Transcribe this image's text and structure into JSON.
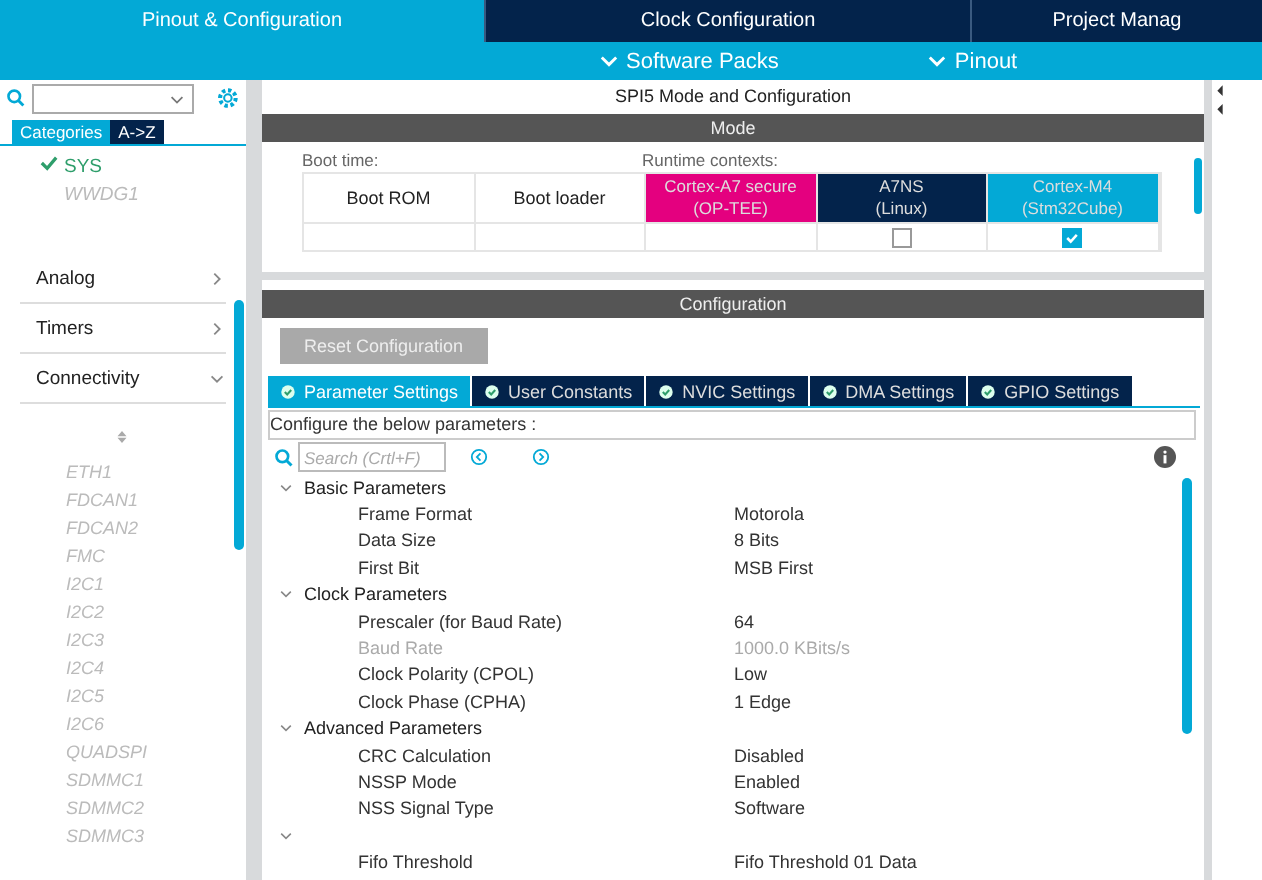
{
  "top_tabs": [
    {
      "label": "Pinout & Configuration",
      "selected": true
    },
    {
      "label": "Clock Configuration",
      "selected": false
    },
    {
      "label": "Project Manag",
      "selected": false
    }
  ],
  "sub_menu": [
    "Software Packs",
    "Pinout"
  ],
  "left": {
    "view_tabs": [
      {
        "label": "Categories",
        "selected": true
      },
      {
        "label": "A->Z",
        "selected": false
      }
    ],
    "peripherals": [
      {
        "label": "SYS",
        "enabled": true
      },
      {
        "label": "WWDG1",
        "enabled": false
      }
    ],
    "categories": [
      {
        "label": "Analog",
        "expanded": false
      },
      {
        "label": "Timers",
        "expanded": false
      },
      {
        "label": "Connectivity",
        "expanded": true,
        "children": [
          "ETH1",
          "FDCAN1",
          "FDCAN2",
          "FMC",
          "I2C1",
          "I2C2",
          "I2C3",
          "I2C4",
          "I2C5",
          "I2C6",
          "QUADSPI",
          "SDMMC1",
          "SDMMC2",
          "SDMMC3"
        ]
      }
    ]
  },
  "panel_title": "SPI5 Mode and Configuration",
  "mode": {
    "header": "Mode",
    "boot_time_label": "Boot time:",
    "runtime_label": "Runtime contexts:",
    "columns": [
      {
        "label": "Boot ROM"
      },
      {
        "label": "Boot loader"
      },
      {
        "label": "Cortex-A7 secure",
        "sublabel": "(OP-TEE)",
        "color": "#e4007f"
      },
      {
        "label": "A7NS",
        "sublabel": "(Linux)",
        "color": "#03234b",
        "checked": false
      },
      {
        "label": "Cortex-M4",
        "sublabel": "(Stm32Cube)",
        "color": "#03a9d6",
        "checked": true
      }
    ]
  },
  "configuration": {
    "header": "Configuration",
    "reset_button": "Reset Configuration",
    "tabs": [
      {
        "label": "Parameter Settings",
        "selected": true
      },
      {
        "label": "User Constants",
        "selected": false
      },
      {
        "label": "NVIC Settings",
        "selected": false
      },
      {
        "label": "DMA Settings",
        "selected": false
      },
      {
        "label": "GPIO Settings",
        "selected": false
      }
    ],
    "hint": "Configure the below parameters :",
    "search": {
      "placeholder": "Search (Crtl+F)"
    },
    "parameters": [
      {
        "kind": "group",
        "label": "Basic Parameters"
      },
      {
        "kind": "param",
        "label": "Frame Format",
        "value": "Motorola",
        "disabled": false
      },
      {
        "kind": "param",
        "label": "Data Size",
        "value": "8 Bits",
        "disabled": false
      },
      {
        "kind": "param",
        "label": "First Bit",
        "value": "MSB First",
        "disabled": false
      },
      {
        "kind": "group",
        "label": "Clock Parameters"
      },
      {
        "kind": "param",
        "label": "Prescaler (for Baud Rate)",
        "value": "64",
        "disabled": false
      },
      {
        "kind": "param",
        "label": "Baud Rate",
        "value": "1000.0 KBits/s",
        "disabled": true
      },
      {
        "kind": "param",
        "label": "Clock Polarity (CPOL)",
        "value": "Low",
        "disabled": false
      },
      {
        "kind": "param",
        "label": "Clock Phase (CPHA)",
        "value": "1 Edge",
        "disabled": false
      },
      {
        "kind": "group",
        "label": "Advanced Parameters"
      },
      {
        "kind": "param",
        "label": "CRC Calculation",
        "value": "Disabled",
        "disabled": false
      },
      {
        "kind": "param",
        "label": "NSSP Mode",
        "value": "Enabled",
        "disabled": false
      },
      {
        "kind": "param",
        "label": "NSS Signal Type",
        "value": "Software",
        "disabled": false
      },
      {
        "kind": "group"
      },
      {
        "kind": "param",
        "label": "Fifo Threshold",
        "value": "Fifo Threshold 01 Data",
        "disabled": false
      }
    ]
  }
}
